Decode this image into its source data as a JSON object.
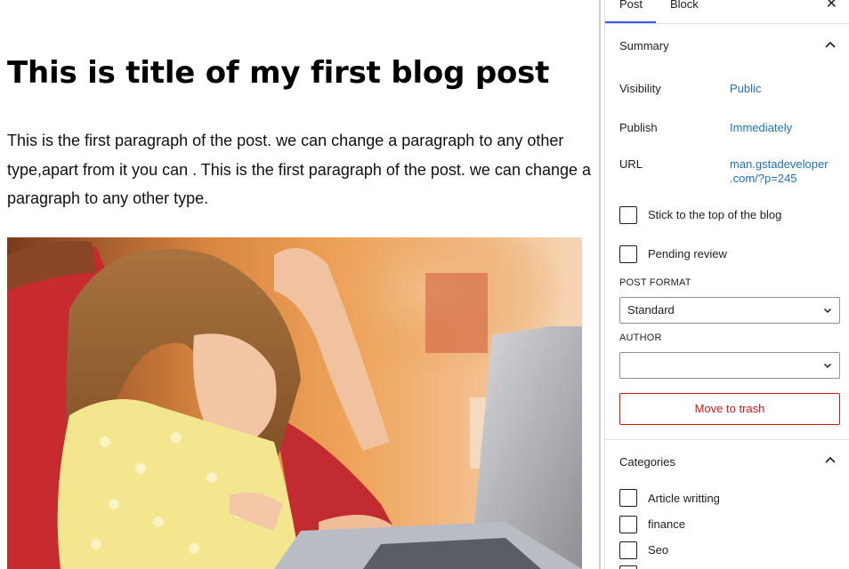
{
  "post": {
    "title": "This is title of my first blog post",
    "paragraph": "This is the first paragraph of the post. we can change a paragraph to any other type,apart from it you can  . This is the first paragraph of the post. we can change a paragraph to any other type."
  },
  "sidebar": {
    "tabs": [
      "Post",
      "Block"
    ],
    "active_tab": "Post",
    "close_icon": "close-icon",
    "summary": {
      "title": "Summary",
      "visibility_label": "Visibility",
      "visibility_value": "Public",
      "publish_label": "Publish",
      "publish_value": "Immediately",
      "url_label": "URL",
      "url_value_line1": "man.gstadeveloper",
      "url_value_line2": ".com/?p=245",
      "stick_label": "Stick to the top of the blog",
      "pending_label": "Pending review",
      "post_format_label": "POST FORMAT",
      "post_format_value": "Standard",
      "author_label": "AUTHOR",
      "author_value": "",
      "trash_label": "Move to trash"
    },
    "categories": {
      "title": "Categories",
      "items": [
        {
          "label": "Article writting",
          "checked": false
        },
        {
          "label": "finance",
          "checked": false
        },
        {
          "label": "Seo",
          "checked": false
        }
      ]
    }
  },
  "colors": {
    "link": "#2271b1",
    "danger": "#cc1818",
    "accent": "#3858e9"
  }
}
